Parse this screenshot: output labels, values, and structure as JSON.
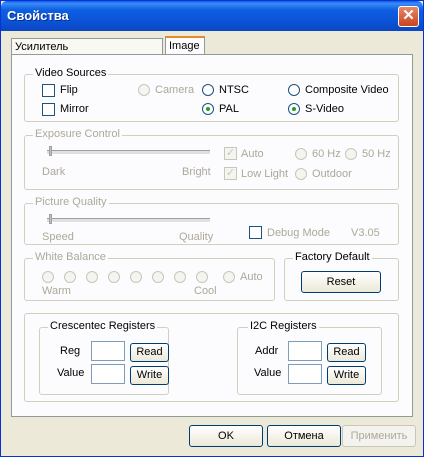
{
  "window": {
    "title": "Свойства",
    "close_glyph": "✕"
  },
  "tabs": [
    {
      "label": "Усилитель видеопроцессора"
    },
    {
      "label": "Image"
    }
  ],
  "video_sources": {
    "legend": "Video Sources",
    "flip": "Flip",
    "mirror": "Mirror",
    "camera": "Camera",
    "ntsc": "NTSC",
    "pal": "PAL",
    "composite": "Composite Video",
    "svideo": "S-Video"
  },
  "exposure": {
    "legend": "Exposure Control",
    "dark": "Dark",
    "bright": "Bright",
    "auto": "Auto",
    "low_light": "Low Light",
    "hz60": "60 Hz",
    "hz50": "50 Hz",
    "outdoor": "Outdoor"
  },
  "quality": {
    "legend": "Picture Quality",
    "speed": "Speed",
    "quality": "Quality",
    "debug_mode": "Debug Mode",
    "version": "V3.05"
  },
  "white_balance": {
    "legend": "White Balance",
    "warm": "Warm",
    "cool": "Cool",
    "auto": "Auto"
  },
  "factory": {
    "legend": "Factory Default",
    "reset": "Reset"
  },
  "crescentec": {
    "legend": "Crescentec Registers",
    "reg": "Reg",
    "value": "Value",
    "read": "Read",
    "write": "Write"
  },
  "i2c": {
    "legend": "I2C Registers",
    "addr": "Addr",
    "value": "Value",
    "read": "Read",
    "write": "Write"
  },
  "footer": {
    "ok": "OK",
    "cancel": "Отмена",
    "apply": "Применить"
  }
}
